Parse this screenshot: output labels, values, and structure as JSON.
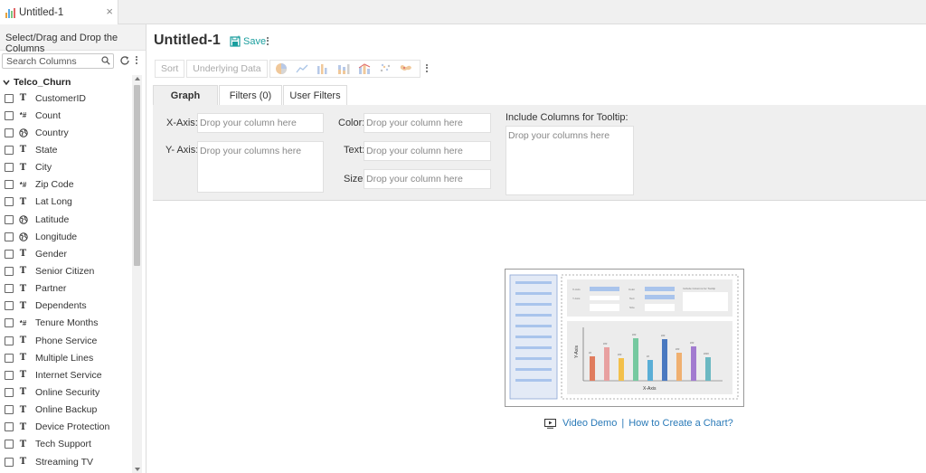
{
  "tab": {
    "title": "Untitled-1",
    "close": "×"
  },
  "left_panel": {
    "header": "Select/Drag and Drop the Columns",
    "search_placeholder": "Search Columns",
    "table_name": "Telco_Churn",
    "columns": [
      {
        "name": "CustomerID",
        "type": "text"
      },
      {
        "name": "Count",
        "type": "number"
      },
      {
        "name": "Country",
        "type": "geo"
      },
      {
        "name": "State",
        "type": "text"
      },
      {
        "name": "City",
        "type": "text"
      },
      {
        "name": "Zip Code",
        "type": "number"
      },
      {
        "name": "Lat Long",
        "type": "text"
      },
      {
        "name": "Latitude",
        "type": "geo"
      },
      {
        "name": "Longitude",
        "type": "geo"
      },
      {
        "name": "Gender",
        "type": "text"
      },
      {
        "name": "Senior Citizen",
        "type": "text"
      },
      {
        "name": "Partner",
        "type": "text"
      },
      {
        "name": "Dependents",
        "type": "text"
      },
      {
        "name": "Tenure Months",
        "type": "number"
      },
      {
        "name": "Phone Service",
        "type": "text"
      },
      {
        "name": "Multiple Lines",
        "type": "text"
      },
      {
        "name": "Internet Service",
        "type": "text"
      },
      {
        "name": "Online Security",
        "type": "text"
      },
      {
        "name": "Online Backup",
        "type": "text"
      },
      {
        "name": "Device Protection",
        "type": "text"
      },
      {
        "name": "Tech Support",
        "type": "text"
      },
      {
        "name": "Streaming TV",
        "type": "text"
      }
    ],
    "type_glyphs": {
      "text": "T",
      "number": "*#"
    }
  },
  "header": {
    "title": "Untitled-1",
    "save_label": "Save"
  },
  "toolbar": {
    "sort_label": "Sort",
    "underlying_label": "Underlying Data",
    "chart_icons": [
      "pie-chart-icon",
      "line-chart-icon",
      "bar-chart-icon",
      "stacked-bar-chart-icon",
      "combo-chart-icon",
      "scatter-chart-icon",
      "map-chart-icon"
    ]
  },
  "config": {
    "tabs": [
      {
        "label": "Graph",
        "active": true
      },
      {
        "label": "Filters  (0)",
        "active": false
      },
      {
        "label": "User Filters",
        "active": false
      }
    ],
    "x_axis_label": "X-Axis:",
    "x_axis_placeholder": "Drop your column here",
    "y_axis_label": "Y- Axis:",
    "y_axis_placeholder": "Drop your columns here",
    "color_label": "Color:",
    "color_placeholder": "Drop your column here",
    "text_label": "Text:",
    "text_placeholder": "Drop your column here",
    "size_label": "Size:",
    "size_placeholder": "Drop your column here",
    "tooltip_label": "Include Columns for Tooltip:",
    "tooltip_placeholder": "Drop your columns here"
  },
  "illustration": {
    "x_axis_caption": "X-Axis",
    "y_axis_caption": "Y-Axis"
  },
  "links": {
    "video_demo": "Video Demo",
    "separator": "|",
    "how_to": "How to Create a Chart?"
  },
  "colors": {
    "accent": "#1a9e9e",
    "link": "#2a7ab8"
  }
}
